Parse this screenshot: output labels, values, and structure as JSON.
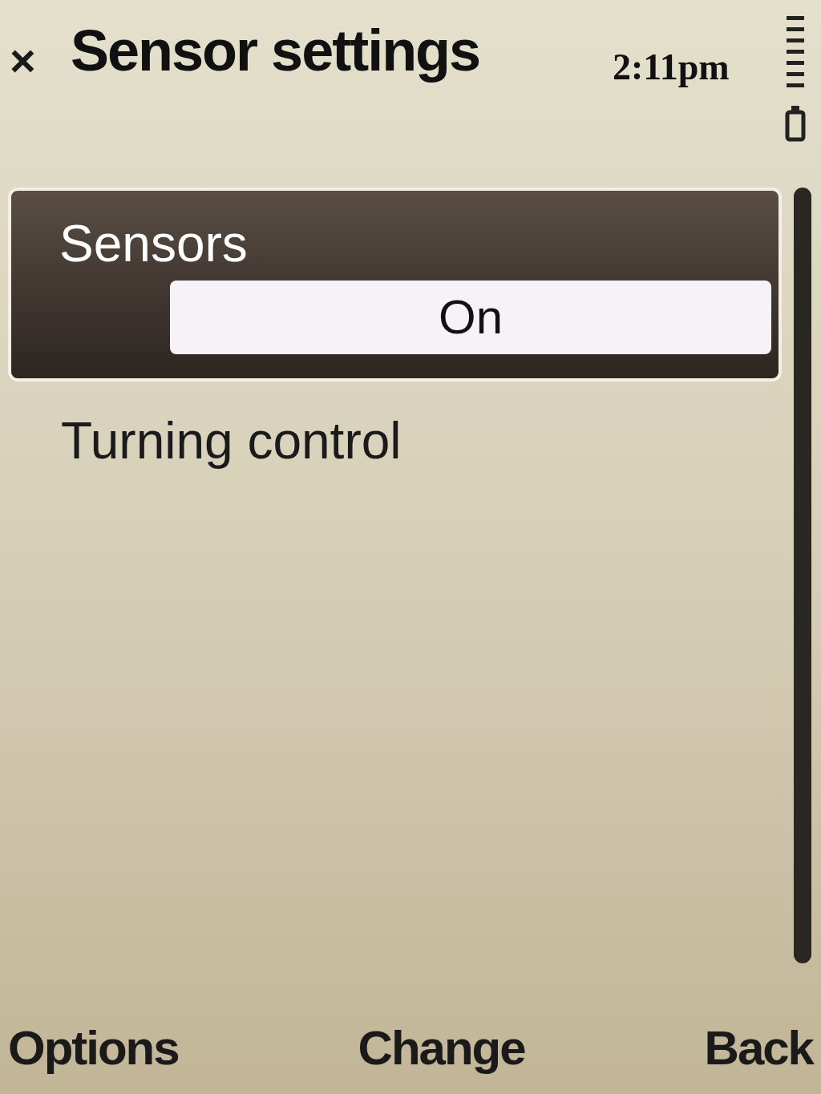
{
  "title_bar": {
    "close": "×",
    "title": "Sensor settings",
    "time": "2:11pm"
  },
  "items": [
    {
      "label": "Sensors",
      "setting": "On",
      "selected": true
    },
    {
      "label": "Turning control",
      "selected": false
    }
  ],
  "softkeys": [
    "Options",
    "Change",
    "Back"
  ]
}
